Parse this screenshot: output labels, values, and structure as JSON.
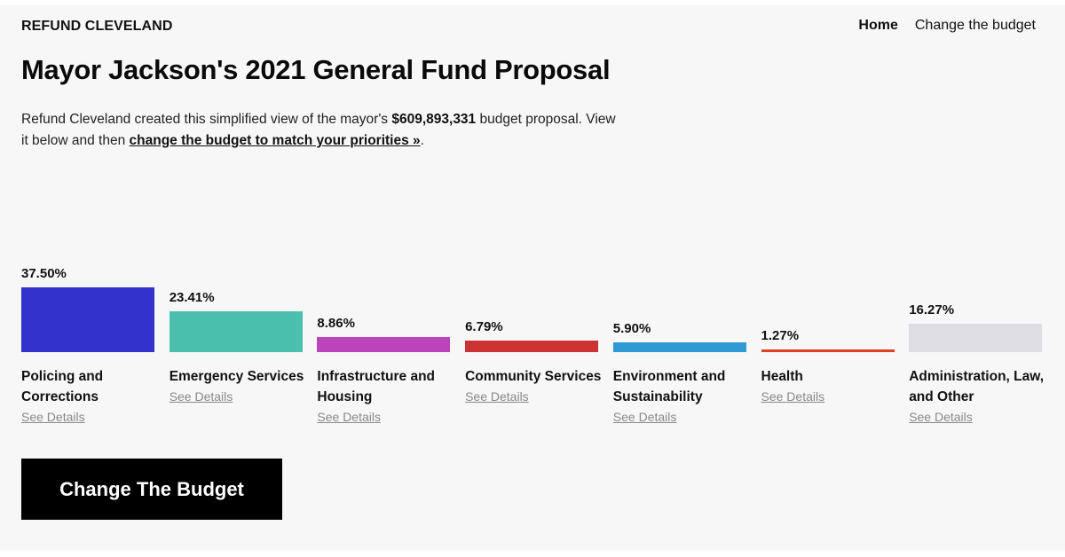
{
  "header": {
    "brand": "REFUND CLEVELAND",
    "nav": [
      "Home",
      "Change the budget"
    ]
  },
  "title": "Mayor Jackson's 2021 General Fund Proposal",
  "intro": {
    "part1": "Refund Cleveland created this simplified view of the mayor's ",
    "amount": "$609,893,331",
    "part2": " budget proposal. View it below and then ",
    "link": "change the budget to match your priorities »",
    "part3": "."
  },
  "see_details_label": "See Details",
  "cta_label": "Change The Budget",
  "chart_data": {
    "type": "bar",
    "categories": [
      "Policing and Corrections",
      "Emergency Services",
      "Infrastructure and Housing",
      "Community Services",
      "Environment and Sustainability",
      "Health",
      "Administration, Law, and Other"
    ],
    "labels": [
      "37.50%",
      "23.41%",
      "8.86%",
      "6.79%",
      "5.90%",
      "1.27%",
      "16.27%"
    ],
    "values": [
      37.5,
      23.41,
      8.86,
      6.79,
      5.9,
      1.27,
      16.27
    ],
    "colors": [
      "#3333cc",
      "#4bbfad",
      "#bb44bb",
      "#cc3333",
      "#2e9bd6",
      "#e04020",
      "#dedde3"
    ],
    "title": "",
    "xlabel": "",
    "ylabel": ""
  }
}
